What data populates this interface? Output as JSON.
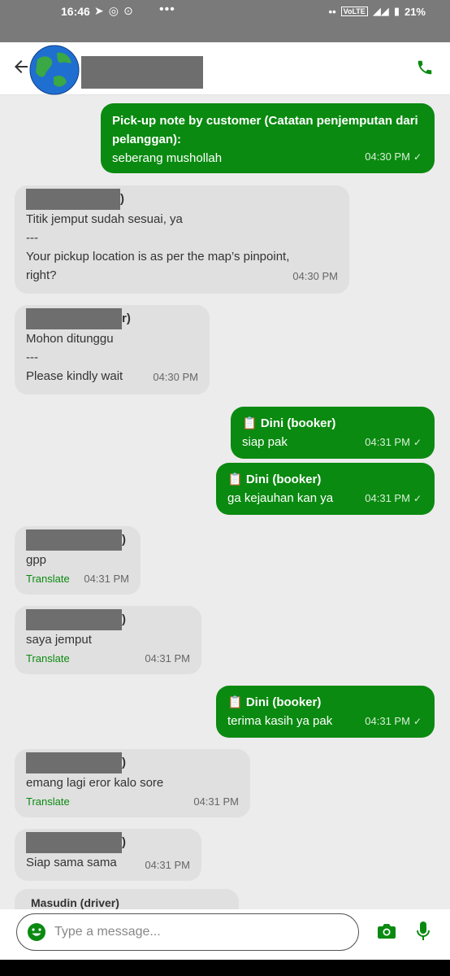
{
  "status_bar": {
    "time": "16:46",
    "battery": "21%",
    "icons": [
      "telegram-icon",
      "whatsapp-icon",
      "app-icon",
      "more-dots",
      "dots-icon",
      "volte-icon",
      "signal-icon",
      "battery-icon"
    ]
  },
  "header": {
    "back_icon": "arrow-left-icon",
    "call_icon": "phone-icon",
    "accent_color": "#0a8a10"
  },
  "messages": [
    {
      "side": "out",
      "title": "Pick-up note by customer (Catatan penjemputan dari pelanggan):",
      "text": "seberang mushollah",
      "time": "04:30 PM"
    },
    {
      "side": "in",
      "suffix": ")",
      "lines": [
        "Titik jemput sudah sesuai, ya",
        "---",
        "Your pickup location is as per the map’s pinpoint, right?"
      ],
      "time": "04:30 PM"
    },
    {
      "side": "in",
      "suffix": "r)",
      "lines": [
        "Mohon ditunggu",
        "---",
        "Please kindly wait"
      ],
      "time": "04:30 PM"
    },
    {
      "side": "out",
      "title": "📋 Dini (booker)",
      "text": "siap pak",
      "time": "04:31 PM"
    },
    {
      "side": "out",
      "title": "📋 Dini (booker)",
      "text": "ga kejauhan kan ya",
      "time": "04:31 PM"
    },
    {
      "side": "in",
      "suffix": ")",
      "lines": [
        "gpp"
      ],
      "translate": "Translate",
      "time": "04:31 PM"
    },
    {
      "side": "in",
      "suffix": ")",
      "lines": [
        "saya jemput"
      ],
      "translate": "Translate",
      "time": "04:31 PM"
    },
    {
      "side": "out",
      "title": "📋 Dini (booker)",
      "text": "terima kasih ya pak",
      "time": "04:31 PM"
    },
    {
      "side": "in",
      "suffix": ")",
      "lines": [
        "emang lagi eror kalo sore"
      ],
      "translate": "Translate",
      "time": "04:31 PM"
    },
    {
      "side": "in",
      "suffix": ")",
      "lines": [
        "Siap sama sama"
      ],
      "time": "04:31 PM"
    },
    {
      "side": "in",
      "partial": "Masudin (driver)"
    }
  ],
  "composer": {
    "placeholder": "Type a message...",
    "emoji_icon": "emoji-icon",
    "camera_icon": "camera-icon",
    "mic_icon": "mic-icon"
  }
}
